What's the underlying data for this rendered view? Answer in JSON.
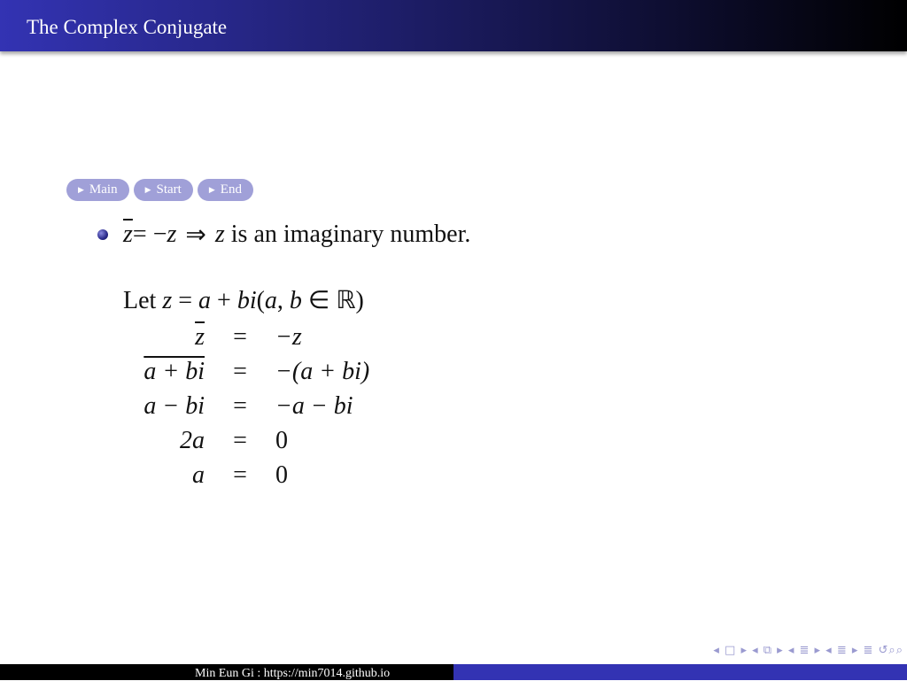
{
  "header": {
    "title": "The Complex Conjugate"
  },
  "nav": [
    {
      "label": "Main"
    },
    {
      "label": "Start"
    },
    {
      "label": "End"
    }
  ],
  "bullet": {
    "zbar": "z",
    "eq": " = −",
    "z": "z",
    "implies": "⇒",
    "z2": "z",
    "rest": " is an imaginary number."
  },
  "let_line": {
    "prefix": "Let ",
    "z": "z",
    "eq": " = ",
    "a": "a",
    "plus": " + ",
    "bi": "bi",
    "paren": "(",
    "a2": "a",
    "comma": ", ",
    "b": "b",
    "in": " ∈ ℝ)"
  },
  "equations": [
    {
      "lhs": "z",
      "lhs_over": true,
      "rhs": "−z"
    },
    {
      "lhs": "a + bi",
      "lhs_over": true,
      "rhs": "−(a + bi)"
    },
    {
      "lhs": "a − bi",
      "lhs_over": false,
      "rhs": "−a − bi"
    },
    {
      "lhs": "2a",
      "lhs_over": false,
      "rhs": "0"
    },
    {
      "lhs": "a",
      "lhs_over": false,
      "rhs": "0"
    }
  ],
  "eq_sign": "=",
  "beamer_nav": "◂ □ ▸ ◂ ⧉ ▸ ◂ ≣ ▸ ◂ ≣ ▸ ≣ ↺⌕⌕",
  "footer": {
    "author": "Min Eun Gi : https://min7014.github.io"
  }
}
